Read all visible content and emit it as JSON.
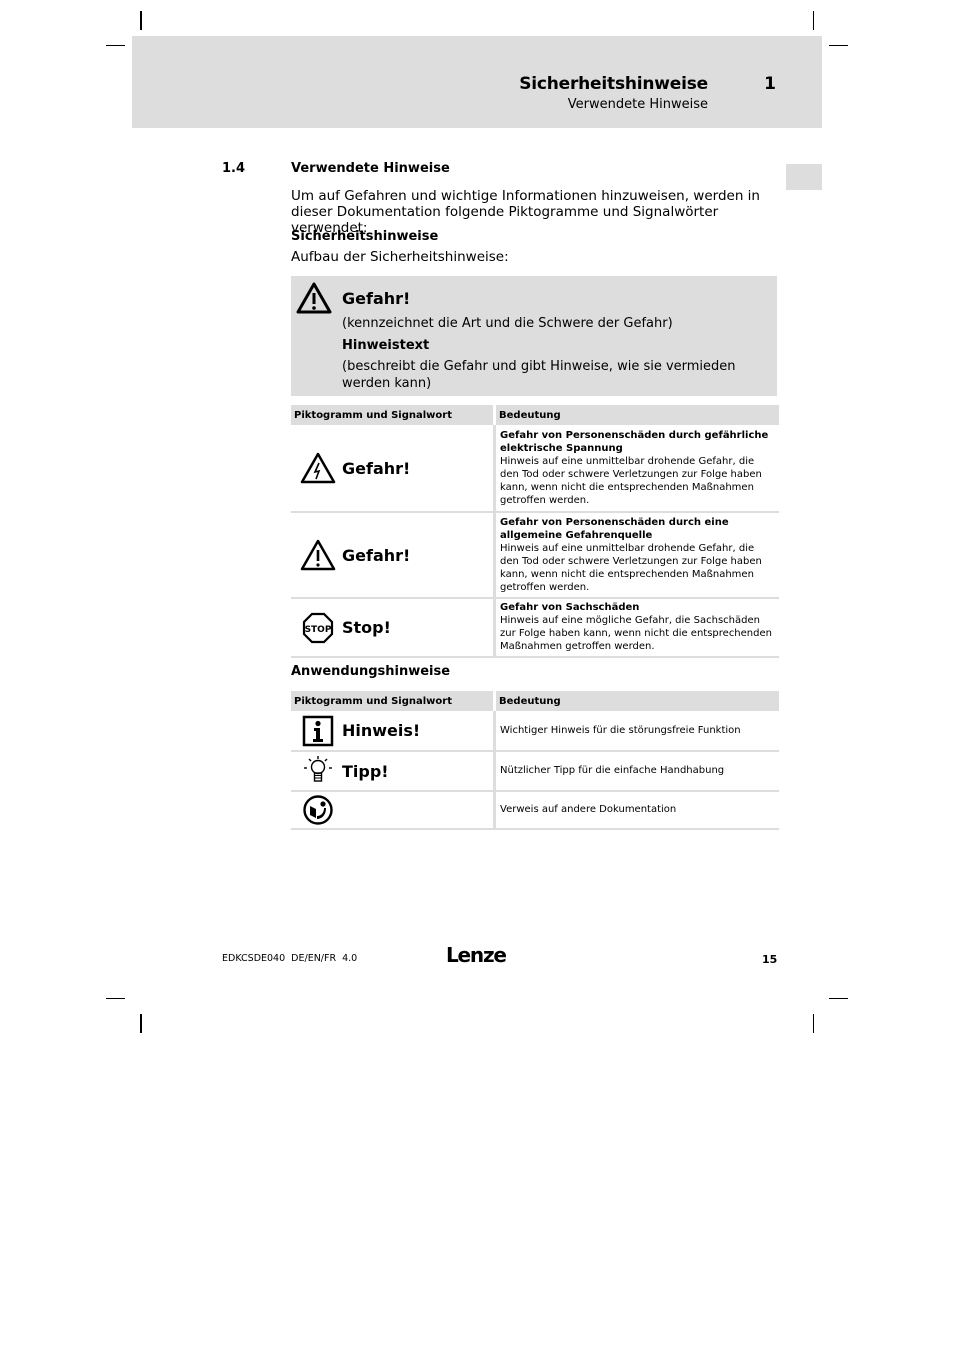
{
  "header": {
    "title": "Sicherheitshinweise",
    "chapter": "1",
    "subtitle": "Verwendete Hinweise"
  },
  "section": {
    "number": "1.4",
    "title": "Verwendete Hinweise",
    "intro": "Um auf Gefahren und wichtige Informationen hinzuweisen, werden in dieser Dokumentation folgende Piktogramme und Signalwörter verwendet:",
    "safety_heading": "Sicherheitshinweise",
    "safety_structure_label": "Aufbau der Sicherheitshinweise:"
  },
  "structure_box": {
    "icon": "warning-triangle-icon",
    "signal_word": "Gefahr!",
    "line1": "(kennzeichnet die Art und die Schwere der Gefahr)",
    "line2": "Hinweistext",
    "line3": "(beschreibt die Gefahr und gibt Hinweise, wie sie vermieden werden kann)"
  },
  "safety_table": {
    "headers": [
      "Piktogramm und Signalwort",
      "Bedeutung"
    ],
    "rows": [
      {
        "icon": "electric-hazard-icon",
        "signal_word": "Gefahr!",
        "title": "Gefahr von Personenschäden durch gefährliche elektrische Spannung",
        "text": "Hinweis auf eine unmittelbar drohende Gefahr, die den Tod oder schwere Verletzungen zur Folge haben kann, wenn nicht die entsprechenden Maßnahmen getroffen werden."
      },
      {
        "icon": "general-hazard-icon",
        "signal_word": "Gefahr!",
        "title": "Gefahr von Personenschäden durch eine allgemeine Gefahrenquelle",
        "text": "Hinweis auf eine unmittelbar drohende Gefahr, die den Tod oder schwere Verletzungen zur Folge haben kann, wenn nicht die entsprechenden Maßnahmen getroffen werden."
      },
      {
        "icon": "stop-sign-icon",
        "signal_word": "Stop!",
        "title": "Gefahr von Sachschäden",
        "text": "Hinweis auf eine mögliche Gefahr, die Sachschäden zur Folge haben kann, wenn nicht die entsprechenden Maßnahmen getroffen werden."
      }
    ]
  },
  "application_heading": "Anwendungshinweise",
  "application_table": {
    "headers": [
      "Piktogramm und Signalwort",
      "Bedeutung"
    ],
    "rows": [
      {
        "icon": "info-icon",
        "signal_word": "Hinweis!",
        "text": "Wichtiger Hinweis für die störungsfreie Funktion"
      },
      {
        "icon": "lightbulb-icon",
        "signal_word": "Tipp!",
        "text": "Nützlicher Tipp für die einfache Handhabung"
      },
      {
        "icon": "reference-docs-icon",
        "signal_word": "",
        "text": "Verweis auf andere Dokumentation"
      }
    ]
  },
  "footer": {
    "doc_id": "EDKCSDE040  DE/EN/FR  4.0",
    "logo": "Lenze",
    "page_number": "15"
  }
}
